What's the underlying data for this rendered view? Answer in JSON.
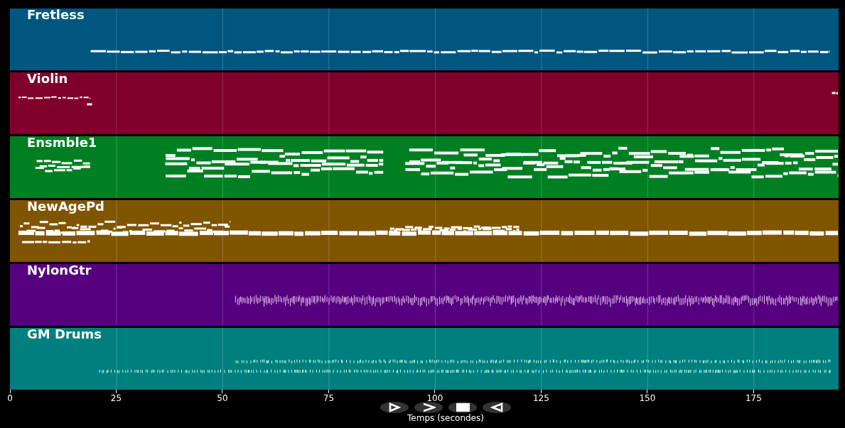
{
  "tracks": [
    {
      "name": "Fretless",
      "color": "#00567f",
      "kind": "bass"
    },
    {
      "name": "Violin",
      "color": "#7f002b",
      "kind": "violin"
    },
    {
      "name": "Ensmble1",
      "color": "#007f22",
      "kind": "ensemble"
    },
    {
      "name": "NewAgePd",
      "color": "#7f5500",
      "kind": "pad"
    },
    {
      "name": "NylonGtr",
      "color": "#55007f",
      "kind": "guitar"
    },
    {
      "name": "GM Drums",
      "color": "#007f7f",
      "kind": "drums"
    }
  ],
  "axis": {
    "ticks": [
      "0",
      "25",
      "50",
      "75",
      "100",
      "125",
      "150",
      "175"
    ],
    "xlabel": "Temps (secondes)"
  },
  "controls": [
    {
      "kind": "play"
    },
    {
      "kind": "forward"
    },
    {
      "kind": "stop"
    },
    {
      "kind": "back"
    }
  ]
}
